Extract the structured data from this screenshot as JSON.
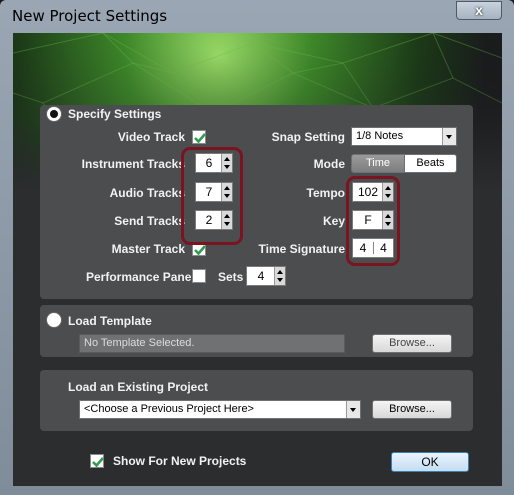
{
  "window": {
    "title": "New Project Settings",
    "close_label": "x"
  },
  "specify": {
    "label": "Specify Settings",
    "video_track_label": "Video Track",
    "instrument_tracks_label": "Instrument Tracks",
    "instrument_tracks_value": "6",
    "audio_tracks_label": "Audio Tracks",
    "audio_tracks_value": "7",
    "send_tracks_label": "Send Tracks",
    "send_tracks_value": "2",
    "master_track_label": "Master Track",
    "performance_panel_label": "Performance Panel",
    "sets_label": "Sets",
    "sets_value": "4",
    "snap_setting_label": "Snap Setting",
    "snap_setting_value": "1/8 Notes",
    "mode_label": "Mode",
    "mode_options": [
      "Time",
      "Beats"
    ],
    "tempo_label": "Tempo",
    "tempo_value": "102",
    "key_label": "Key",
    "key_value": "F",
    "time_signature_label": "Time Signature",
    "time_signature_num": "4",
    "time_signature_den": "4"
  },
  "load_template": {
    "label": "Load Template",
    "value": "No Template Selected.",
    "browse_label": "Browse..."
  },
  "load_project": {
    "label": "Load an Existing Project",
    "placeholder": "<Choose a Previous Project Here>",
    "browse_label": "Browse..."
  },
  "footer": {
    "show_label": "Show For New Projects",
    "ok_label": "OK"
  },
  "colors": {
    "highlight": "#7a1420",
    "check": "#2e9e4e"
  }
}
